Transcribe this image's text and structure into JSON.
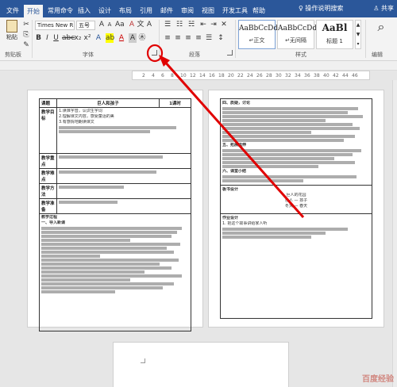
{
  "ribbon_tabs": [
    "文件",
    "开始",
    "常用命令",
    "插入",
    "设计",
    "布局",
    "引用",
    "邮件",
    "审阅",
    "视图",
    "开发工具",
    "帮助"
  ],
  "search_label": "操作说明搜索",
  "share_label": "共享",
  "clipboard": {
    "paste_label": "粘贴",
    "group_label": "剪贴板"
  },
  "font": {
    "name_value": "Times New R",
    "size_value": "五号",
    "group_label": "字体"
  },
  "paragraph": {
    "group_label": "段落"
  },
  "styles": {
    "group_label": "样式",
    "items": [
      {
        "sample": "AaBbCcDd",
        "name": "↵正文"
      },
      {
        "sample": "AaBbCcDd",
        "name": "↵无间隔"
      },
      {
        "sample": "AaBl",
        "name": "标题 1"
      }
    ]
  },
  "editing": {
    "group_label": "编辑"
  },
  "ruler_ticks": [
    "2",
    "4",
    "6",
    "8",
    "10",
    "12",
    "14",
    "16",
    "18",
    "20",
    "22",
    "24",
    "26",
    "28",
    "30",
    "32",
    "34",
    "36",
    "38",
    "40",
    "42",
    "44",
    "46"
  ],
  "page1": {
    "title": "巨人和孩子",
    "label_course": "课题",
    "label_period": "1课时",
    "label_goals": "教学目标",
    "goal_lines": [
      "1.读准字音，认识生字词",
      "2.理解课文内容，感受童话的美",
      "3.有感情地朗读课文"
    ],
    "label_key": "教学重点",
    "label_difficult": "教学难点",
    "label_method": "教学方法",
    "label_prep": "教学准备",
    "label_process": "教学过程",
    "section1": "一、导入新课"
  },
  "page2": {
    "heading1": "四、质疑，讨论",
    "heading2": "五、拓展延伸",
    "heading3": "六、课堂小结",
    "label_board": "板书设计",
    "label_homework": "作业设计",
    "board_lines": [
      "巨人的花园",
      "巨人 — 孩子",
      "冬天 — 春天"
    ],
    "homework": "1. 把这个故事讲给家人听"
  },
  "watermark": "百度经验"
}
